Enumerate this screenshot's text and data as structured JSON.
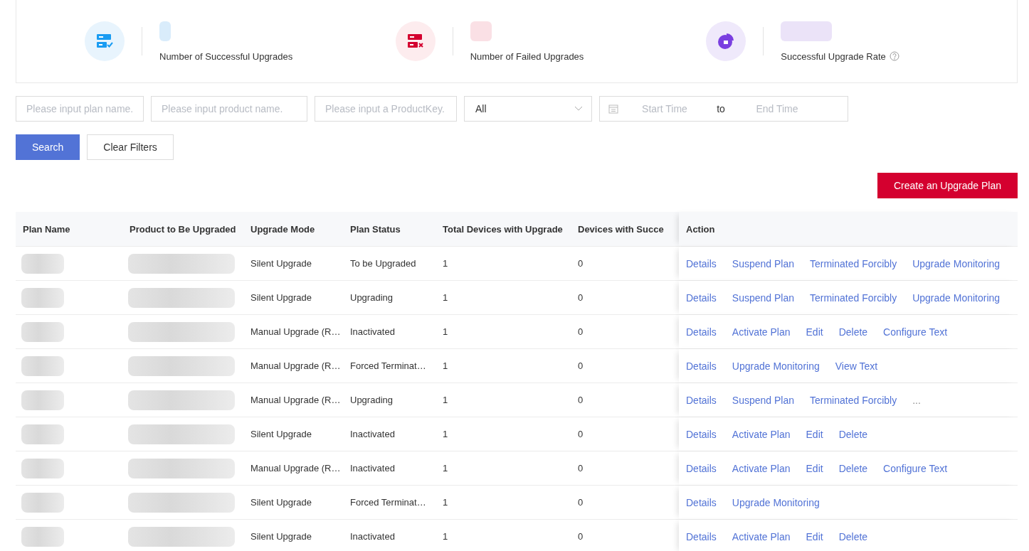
{
  "stats": [
    {
      "kind": "success",
      "label": "Number of Successful Upgrades",
      "help": false
    },
    {
      "kind": "failed",
      "label": "Number of Failed Upgrades",
      "help": false
    },
    {
      "kind": "rate",
      "label": "Successful Upgrade Rate",
      "help": true
    }
  ],
  "filters": {
    "plan_name": {
      "placeholder": "Please input plan name."
    },
    "product_name": {
      "placeholder": "Please input product name."
    },
    "product_key": {
      "placeholder": "Please input a ProductKey."
    },
    "status_select": {
      "value": "All"
    },
    "date_range": {
      "start_placeholder": "Start Time",
      "separator": "to",
      "end_placeholder": "End Time"
    }
  },
  "buttons": {
    "search": "Search",
    "clear": "Clear Filters",
    "create": "Create an Upgrade Plan"
  },
  "table": {
    "columns": [
      "Plan Name",
      "Product to Be Upgraded",
      "Upgrade Mode",
      "Plan Status",
      "Total Devices with Upgrade",
      "Devices with Succe",
      "Action"
    ],
    "rows": [
      {
        "mode": "Silent Upgrade",
        "status": "To be Upgraded",
        "total": "1",
        "success": "0",
        "actions": [
          "Details",
          "Suspend Plan",
          "Terminated Forcibly",
          "Upgrade Monitoring"
        ]
      },
      {
        "mode": "Silent Upgrade",
        "status": "Upgrading",
        "total": "1",
        "success": "0",
        "actions": [
          "Details",
          "Suspend Plan",
          "Terminated Forcibly",
          "Upgrade Monitoring"
        ]
      },
      {
        "mode": "Manual Upgrade (R…",
        "status": "Inactivated",
        "total": "1",
        "success": "0",
        "actions": [
          "Details",
          "Activate Plan",
          "Edit",
          "Delete",
          "Configure Text"
        ]
      },
      {
        "mode": "Manual Upgrade (R…",
        "status": "Forced Terminat…",
        "total": "1",
        "success": "0",
        "actions": [
          "Details",
          "Upgrade Monitoring",
          "View Text"
        ]
      },
      {
        "mode": "Manual Upgrade (R…",
        "status": "Upgrading",
        "total": "1",
        "success": "0",
        "actions": [
          "Details",
          "Suspend Plan",
          "Terminated Forcibly",
          "..."
        ]
      },
      {
        "mode": "Silent Upgrade",
        "status": "Inactivated",
        "total": "1",
        "success": "0",
        "actions": [
          "Details",
          "Activate Plan",
          "Edit",
          "Delete"
        ]
      },
      {
        "mode": "Manual Upgrade (R…",
        "status": "Inactivated",
        "total": "1",
        "success": "0",
        "actions": [
          "Details",
          "Activate Plan",
          "Edit",
          "Delete",
          "Configure Text"
        ]
      },
      {
        "mode": "Silent Upgrade",
        "status": "Forced Terminat…",
        "total": "1",
        "success": "0",
        "actions": [
          "Details",
          "Upgrade Monitoring"
        ]
      },
      {
        "mode": "Silent Upgrade",
        "status": "Inactivated",
        "total": "1",
        "success": "0",
        "actions": [
          "Details",
          "Activate Plan",
          "Edit",
          "Delete"
        ]
      }
    ]
  }
}
